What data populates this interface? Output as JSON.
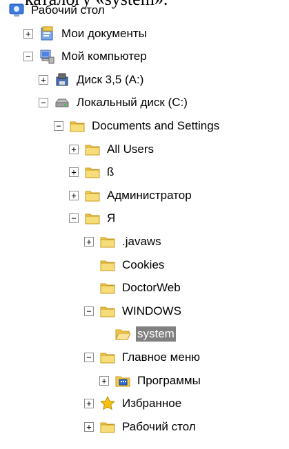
{
  "header_text": "каталогу «system».",
  "icons": {
    "folder": "folder-icon",
    "folder_open": "folder-open-icon",
    "desktop": "desktop-icon",
    "documents": "my-documents-icon",
    "computer": "computer-icon",
    "floppy": "floppy-drive-icon",
    "hdd": "hard-drive-icon",
    "programs": "programs-folder-icon",
    "favorites": "favorites-star-icon"
  },
  "tree": [
    {
      "label": "Рабочий стол",
      "icon": "desktop",
      "expander": "none",
      "level": 0
    },
    {
      "label": "Мои документы",
      "icon": "documents",
      "expander": "plus",
      "level": 1
    },
    {
      "label": "Мой компьютер",
      "icon": "computer",
      "expander": "minus",
      "level": 1
    },
    {
      "label": "Диск 3,5 (A:)",
      "icon": "floppy",
      "expander": "plus",
      "level": 2
    },
    {
      "label": "Локальный диск (C:)",
      "icon": "hdd",
      "expander": "minus",
      "level": 2
    },
    {
      "label": "Documents and Settings",
      "icon": "folder",
      "expander": "minus",
      "level": 3
    },
    {
      "label": "All Users",
      "icon": "folder",
      "expander": "plus",
      "level": 4
    },
    {
      "label": "ß",
      "icon": "folder",
      "expander": "plus",
      "level": 4
    },
    {
      "label": "Администратор",
      "icon": "folder",
      "expander": "plus",
      "level": 4
    },
    {
      "label": "Я",
      "icon": "folder",
      "expander": "minus",
      "level": 4
    },
    {
      "label": ".javaws",
      "icon": "folder",
      "expander": "plus",
      "level": 5
    },
    {
      "label": "Cookies",
      "icon": "folder",
      "expander": "none",
      "level": 5
    },
    {
      "label": "DoctorWeb",
      "icon": "folder",
      "expander": "none",
      "level": 5
    },
    {
      "label": "WINDOWS",
      "icon": "folder",
      "expander": "minus",
      "level": 5
    },
    {
      "label": "system",
      "icon": "folder_open",
      "expander": "none",
      "level": 6,
      "selected": true
    },
    {
      "label": "Главное меню",
      "icon": "folder",
      "expander": "minus",
      "level": 5
    },
    {
      "label": "Программы",
      "icon": "programs",
      "expander": "plus",
      "level": 6
    },
    {
      "label": "Избранное",
      "icon": "favorites",
      "expander": "plus",
      "level": 5
    },
    {
      "label": "Рабочий стол",
      "icon": "folder",
      "expander": "plus",
      "level": 5
    }
  ]
}
